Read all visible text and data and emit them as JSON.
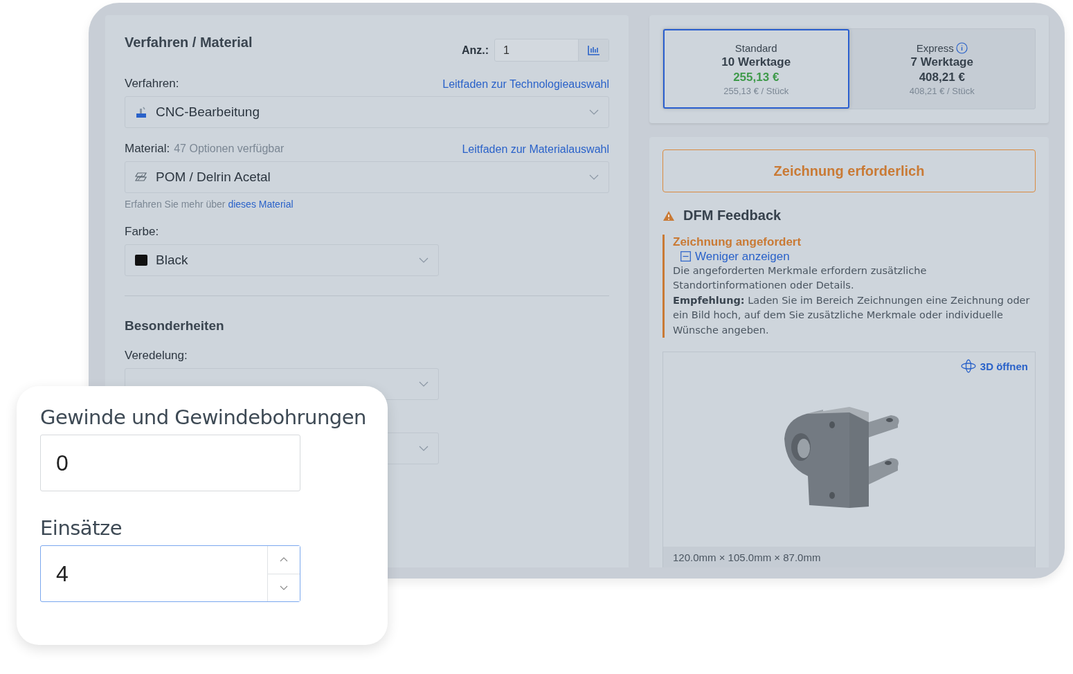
{
  "config": {
    "title": "Verfahren / Material",
    "quantity": {
      "label": "Anz.:",
      "value": "1"
    },
    "process": {
      "label": "Verfahren:",
      "guide_link": "Leitfaden zur Technologieauswahl",
      "value": "CNC-Bearbeitung"
    },
    "material": {
      "label": "Material:",
      "options_hint": "47 Optionen verfügbar",
      "guide_link": "Leitfaden zur Materialauswahl",
      "value": "POM / Delrin Acetal",
      "learn_more": "Erfahren Sie mehr über",
      "learn_more_link": "dieses Material"
    },
    "color": {
      "label": "Farbe:",
      "value": "Black"
    },
    "special": {
      "title": "Besonderheiten",
      "finish": {
        "label": "Veredelung:"
      }
    }
  },
  "shipping": [
    {
      "name": "Standard",
      "days": "10 Werktage",
      "price": "255,13 €",
      "unit_price": "255,13 € / Stück",
      "info": false,
      "selected": true
    },
    {
      "name": "Express",
      "days": "7 Werktage",
      "price": "408,21 €",
      "unit_price": "408,21 € / Stück",
      "info": true,
      "selected": false
    }
  ],
  "feedback": {
    "banner": "Zeichnung erforderlich",
    "title": "DFM Feedback",
    "issue": {
      "title": "Zeichnung angefordert",
      "toggle": "Weniger anzeigen",
      "expanded": true,
      "text": "Die angeforderten Merkmale erfordern zusätzliche Standortinformationen oder Details.",
      "recommendation": "**Empfehlung:** Laden Sie im Bereich Zeichnungen eine Zeichnung oder ein Bild hoch, auf dem Sie zusätzliche Merkmale oder individuelle Wünsche angeben."
    }
  },
  "model": {
    "open_3d": "3D öffnen",
    "dimensions": "120.0mm × 105.0mm × 87.0mm"
  },
  "overlay": {
    "fields": [
      {
        "label": "Gewinde und Gewindebohrungen",
        "value": "0",
        "kind": "text",
        "focused": false
      },
      {
        "label": "Einsätze",
        "value": "4",
        "kind": "number",
        "focused": true
      }
    ]
  }
}
